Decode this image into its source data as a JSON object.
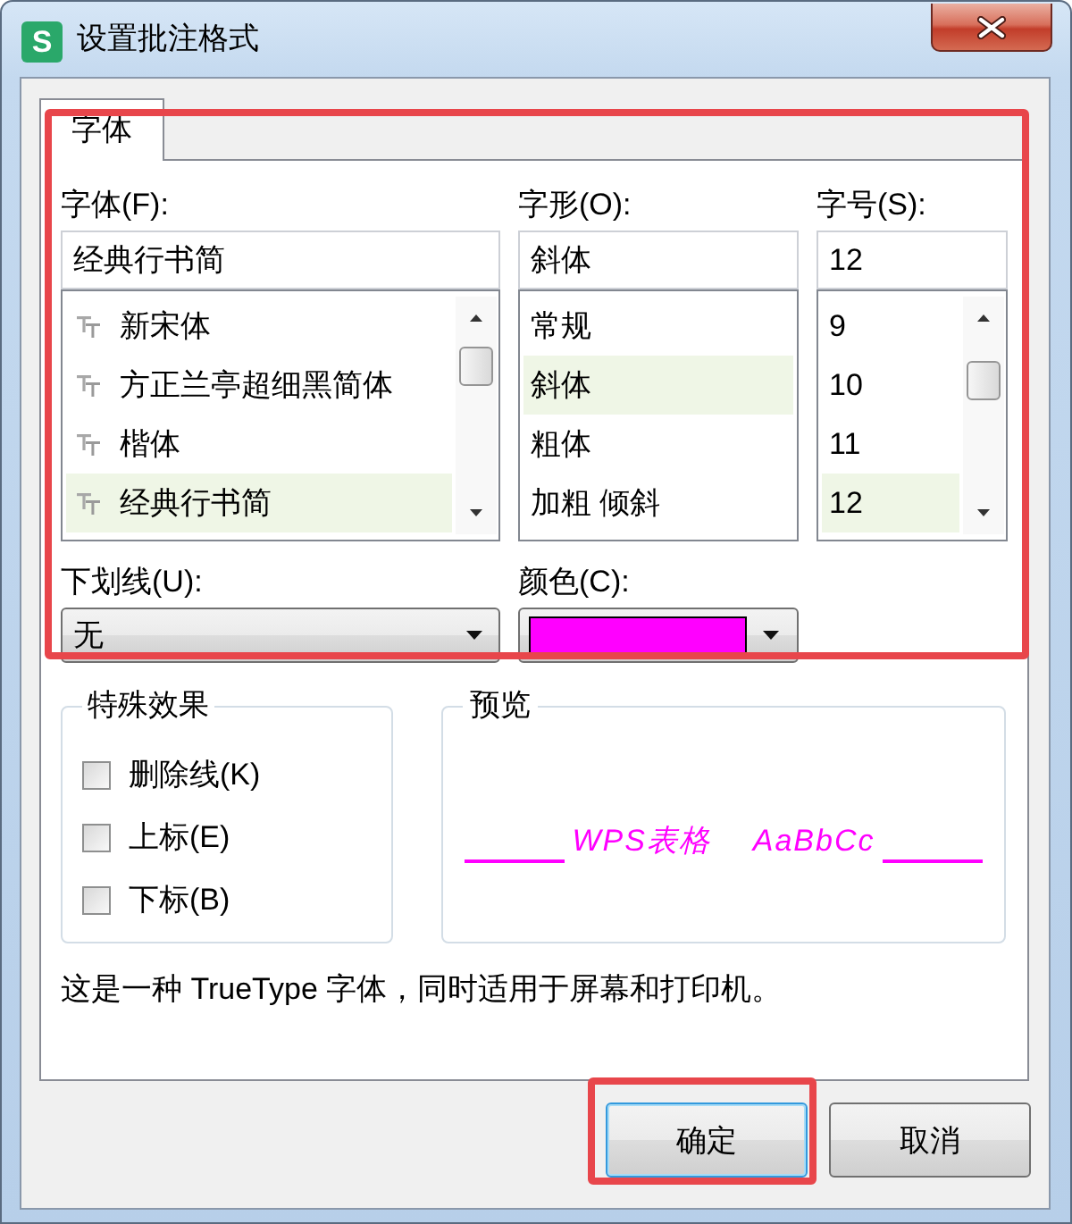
{
  "window": {
    "icon_text": "S",
    "title": "设置批注格式"
  },
  "tabs": [
    {
      "label": "字体",
      "selected": true
    }
  ],
  "font_settings": {
    "highlighted": true,
    "font": {
      "label": "字体(F):",
      "value": "经典行书简",
      "items": [
        {
          "label": "新宋体",
          "selected": false
        },
        {
          "label": "方正兰亭超细黑简体",
          "selected": false
        },
        {
          "label": "楷体",
          "selected": false
        },
        {
          "label": "经典行书简",
          "selected": true
        }
      ]
    },
    "style": {
      "label": "字形(O):",
      "value": "斜体",
      "items": [
        {
          "label": "常规",
          "selected": false
        },
        {
          "label": "斜体",
          "selected": true
        },
        {
          "label": "粗体",
          "selected": false
        },
        {
          "label": "加粗 倾斜",
          "selected": false
        }
      ]
    },
    "size": {
      "label": "字号(S):",
      "value": "12",
      "items": [
        {
          "label": "9",
          "selected": false
        },
        {
          "label": "10",
          "selected": false
        },
        {
          "label": "11",
          "selected": false
        },
        {
          "label": "12",
          "selected": true
        }
      ]
    },
    "underline": {
      "label": "下划线(U):",
      "value": "无"
    },
    "color": {
      "label": "颜色(C):",
      "color": "#ff00ff"
    }
  },
  "effects": {
    "title": "特殊效果",
    "options": [
      {
        "label": "删除线(K)",
        "checked": false
      },
      {
        "label": "上标(E)",
        "checked": false
      },
      {
        "label": "下标(B)",
        "checked": false
      }
    ]
  },
  "preview": {
    "title": "预览",
    "text": "WPS表格  AaBbCc"
  },
  "description": "这是一种 TrueType 字体，同时适用于屏幕和打印机。",
  "buttons": [
    {
      "label": "确定",
      "default": true,
      "highlighted": true
    },
    {
      "label": "取消",
      "default": false,
      "highlighted": false
    }
  ]
}
